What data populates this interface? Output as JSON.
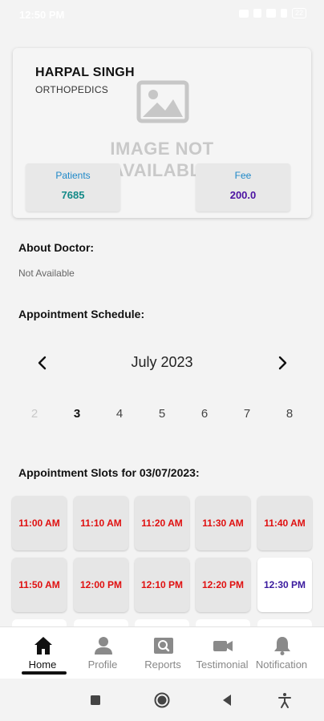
{
  "status_bar": {
    "time": "12:50 PM",
    "battery": "22"
  },
  "doctor": {
    "name": "HARPAL SINGH",
    "specialty": "ORTHOPEDICS",
    "image_placeholder_text": "IMAGE NOT AVAILABLE",
    "patients_label": "Patients",
    "patients_value": "7685",
    "fee_label": "Fee",
    "fee_value": "200.0"
  },
  "about": {
    "heading": "About Doctor:",
    "text": "Not Available"
  },
  "schedule": {
    "heading": "Appointment Schedule:",
    "month": "July 2023",
    "days": [
      {
        "label": "2",
        "state": "disabled"
      },
      {
        "label": "3",
        "state": "selected"
      },
      {
        "label": "4",
        "state": "normal"
      },
      {
        "label": "5",
        "state": "normal"
      },
      {
        "label": "6",
        "state": "normal"
      },
      {
        "label": "7",
        "state": "normal"
      },
      {
        "label": "8",
        "state": "normal"
      }
    ]
  },
  "slots": {
    "heading": "Appointment Slots for 03/07/2023:",
    "items": [
      {
        "time": "11:00 AM",
        "status": "booked"
      },
      {
        "time": "11:10 AM",
        "status": "booked"
      },
      {
        "time": "11:20 AM",
        "status": "booked"
      },
      {
        "time": "11:30 AM",
        "status": "booked"
      },
      {
        "time": "11:40 AM",
        "status": "booked"
      },
      {
        "time": "11:50 AM",
        "status": "booked"
      },
      {
        "time": "12:00 PM",
        "status": "booked"
      },
      {
        "time": "12:10 PM",
        "status": "booked"
      },
      {
        "time": "12:20 PM",
        "status": "booked"
      },
      {
        "time": "12:30 PM",
        "status": "available"
      }
    ],
    "colors": {
      "booked": "#e01010",
      "available": "#3a1a9e"
    }
  },
  "bottom_nav": {
    "items": [
      {
        "label": "Home",
        "icon": "home-icon",
        "active": true
      },
      {
        "label": "Profile",
        "icon": "person-icon",
        "active": false
      },
      {
        "label": "Reports",
        "icon": "reports-icon",
        "active": false
      },
      {
        "label": "Testimonial",
        "icon": "video-camera-icon",
        "active": false
      },
      {
        "label": "Notification",
        "icon": "bell-icon",
        "active": false
      }
    ]
  }
}
